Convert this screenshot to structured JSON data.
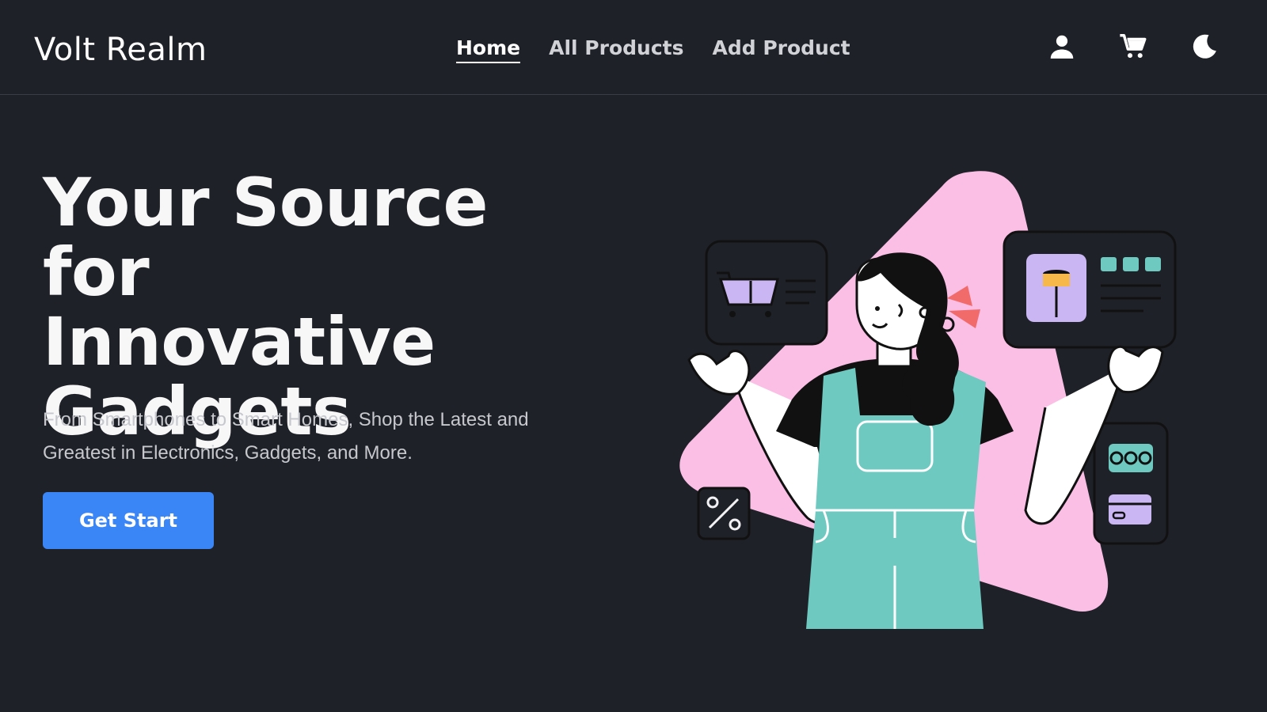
{
  "header": {
    "brand": "Volt Realm",
    "nav": [
      {
        "label": "Home",
        "active": true
      },
      {
        "label": "All Products",
        "active": false
      },
      {
        "label": "Add Product",
        "active": false
      }
    ],
    "icons": [
      "user-icon",
      "cart-icon",
      "moon-icon"
    ]
  },
  "hero": {
    "title_lines": [
      "Your Source for",
      "Innovative",
      "Gadgets"
    ],
    "subtitle": "From Smartphones to Smart Homes, Shop the Latest and Greatest in Electronics, Gadgets, and More.",
    "cta_label": "Get Start"
  },
  "colors": {
    "background": "#1f2128",
    "accent": "#3b86f7",
    "illustration_pink": "#fbbfe6",
    "illustration_teal": "#6ec9c0",
    "illustration_lavender": "#c9b6f3"
  }
}
